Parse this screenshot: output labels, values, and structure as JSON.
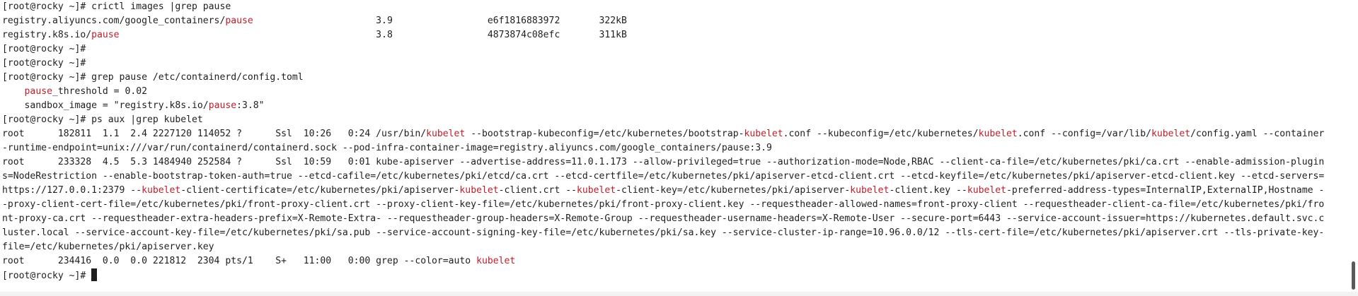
{
  "terminal": {
    "lines": [
      {
        "segments": [
          {
            "text": "[root@rocky ~]# crictl images |grep pause",
            "hl": false
          }
        ]
      },
      {
        "segments": [
          {
            "text": "registry.aliyuncs.com/google_containers/",
            "hl": false
          },
          {
            "text": "pause",
            "hl": true
          },
          {
            "text": "                      3.9                 e6f1816883972       322kB",
            "hl": false
          }
        ]
      },
      {
        "segments": [
          {
            "text": "registry.k8s.io/",
            "hl": false
          },
          {
            "text": "pause",
            "hl": true
          },
          {
            "text": "                                              3.8                 4873874c08efc       311kB",
            "hl": false
          }
        ]
      },
      {
        "segments": [
          {
            "text": "[root@rocky ~]#",
            "hl": false
          }
        ]
      },
      {
        "segments": [
          {
            "text": "[root@rocky ~]#",
            "hl": false
          }
        ]
      },
      {
        "segments": [
          {
            "text": "[root@rocky ~]# grep pause /etc/containerd/config.toml",
            "hl": false
          }
        ]
      },
      {
        "segments": [
          {
            "text": "    ",
            "hl": false
          },
          {
            "text": "pause",
            "hl": true
          },
          {
            "text": "_threshold = 0.02",
            "hl": false
          }
        ]
      },
      {
        "segments": [
          {
            "text": "    sandbox_image = \"registry.k8s.io/",
            "hl": false
          },
          {
            "text": "pause",
            "hl": true
          },
          {
            "text": ":3.8\"",
            "hl": false
          }
        ]
      },
      {
        "segments": [
          {
            "text": "[root@rocky ~]# ps aux |grep kubelet",
            "hl": false
          }
        ]
      },
      {
        "segments": [
          {
            "text": "root      182811  1.1  2.4 2227120 114052 ?      Ssl  10:26   0:24 /usr/bin/",
            "hl": false
          },
          {
            "text": "kubelet",
            "hl": true
          },
          {
            "text": " --bootstrap-kubeconfig=/etc/kubernetes/bootstrap-",
            "hl": false
          },
          {
            "text": "kubelet",
            "hl": true
          },
          {
            "text": ".conf --kubeconfig=/etc/kubernetes/",
            "hl": false
          },
          {
            "text": "kubelet",
            "hl": true
          },
          {
            "text": ".conf --config=/var/lib/",
            "hl": false
          },
          {
            "text": "kubelet",
            "hl": true
          },
          {
            "text": "/config.yaml --container",
            "hl": false
          }
        ]
      },
      {
        "segments": [
          {
            "text": "-runtime-endpoint=unix:///var/run/containerd/containerd.sock --pod-infra-container-image=registry.aliyuncs.com/google_containers/pause:3.9",
            "hl": false
          }
        ]
      },
      {
        "segments": [
          {
            "text": "root      233328  4.5  5.3 1484940 252584 ?      Ssl  10:59   0:01 kube-apiserver --advertise-address=11.0.1.173 --allow-privileged=true --authorization-mode=Node,RBAC --client-ca-file=/etc/kubernetes/pki/ca.crt --enable-admission-plugin",
            "hl": false
          }
        ]
      },
      {
        "segments": [
          {
            "text": "s=NodeRestriction --enable-bootstrap-token-auth=true --etcd-cafile=/etc/kubernetes/pki/etcd/ca.crt --etcd-certfile=/etc/kubernetes/pki/apiserver-etcd-client.crt --etcd-keyfile=/etc/kubernetes/pki/apiserver-etcd-client.key --etcd-servers=",
            "hl": false
          }
        ]
      },
      {
        "segments": [
          {
            "text": "https://127.0.0.1:2379 --",
            "hl": false
          },
          {
            "text": "kubelet",
            "hl": true
          },
          {
            "text": "-client-certificate=/etc/kubernetes/pki/apiserver-",
            "hl": false
          },
          {
            "text": "kubelet",
            "hl": true
          },
          {
            "text": "-client.crt --",
            "hl": false
          },
          {
            "text": "kubelet",
            "hl": true
          },
          {
            "text": "-client-key=/etc/kubernetes/pki/apiserver-",
            "hl": false
          },
          {
            "text": "kubelet",
            "hl": true
          },
          {
            "text": "-client.key --",
            "hl": false
          },
          {
            "text": "kubelet",
            "hl": true
          },
          {
            "text": "-preferred-address-types=InternalIP,ExternalIP,Hostname -",
            "hl": false
          }
        ]
      },
      {
        "segments": [
          {
            "text": "-proxy-client-cert-file=/etc/kubernetes/pki/front-proxy-client.crt --proxy-client-key-file=/etc/kubernetes/pki/front-proxy-client.key --requestheader-allowed-names=front-proxy-client --requestheader-client-ca-file=/etc/kubernetes/pki/fro",
            "hl": false
          }
        ]
      },
      {
        "segments": [
          {
            "text": "nt-proxy-ca.crt --requestheader-extra-headers-prefix=X-Remote-Extra- --requestheader-group-headers=X-Remote-Group --requestheader-username-headers=X-Remote-User --secure-port=6443 --service-account-issuer=https://kubernetes.default.svc.c",
            "hl": false
          }
        ]
      },
      {
        "segments": [
          {
            "text": "luster.local --service-account-key-file=/etc/kubernetes/pki/sa.pub --service-account-signing-key-file=/etc/kubernetes/pki/sa.key --service-cluster-ip-range=10.96.0.0/12 --tls-cert-file=/etc/kubernetes/pki/apiserver.crt --tls-private-key-",
            "hl": false
          }
        ]
      },
      {
        "segments": [
          {
            "text": "file=/etc/kubernetes/pki/apiserver.key",
            "hl": false
          }
        ]
      },
      {
        "segments": [
          {
            "text": "root      234416  0.0  0.0 221812  2304 pts/1    S+   11:00   0:00 grep --color=auto ",
            "hl": false
          },
          {
            "text": "kubelet",
            "hl": true
          }
        ]
      },
      {
        "segments": [
          {
            "text": "[root@rocky ~]# ",
            "hl": false
          }
        ],
        "cursor": true
      }
    ]
  },
  "colors": {
    "background": "#ffffff",
    "foreground": "#1e1e1e",
    "highlight": "#c01c28",
    "scroll_thumb": "#5a5a5a"
  },
  "icons": {
    "cursor": "block-cursor"
  }
}
